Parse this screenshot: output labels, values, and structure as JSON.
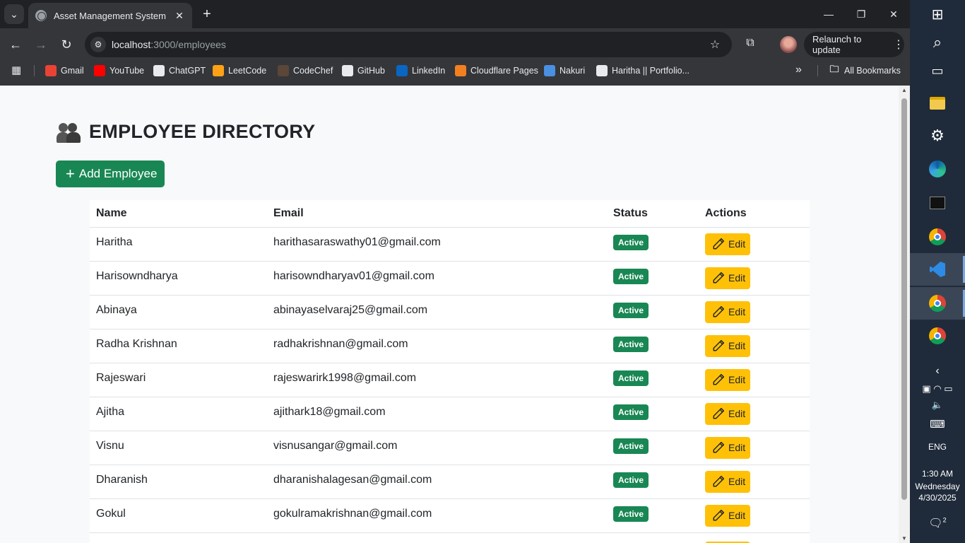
{
  "browser": {
    "tab_title": "Asset Management System",
    "url_host": "localhost",
    "url_path": ":3000/employees",
    "relaunch_label": "Relaunch to update",
    "bookmarks": [
      {
        "label": "Gmail",
        "icon": "gmail-icon",
        "color": "#ea4335"
      },
      {
        "label": "YouTube",
        "icon": "youtube-icon",
        "color": "#ff0000"
      },
      {
        "label": "ChatGPT",
        "icon": "chatgpt-icon",
        "color": "#e8eaed"
      },
      {
        "label": "LeetCode",
        "icon": "leetcode-icon",
        "color": "#ffa116"
      },
      {
        "label": "CodeChef",
        "icon": "codechef-icon",
        "color": "#5b4638"
      },
      {
        "label": "GitHub",
        "icon": "github-icon",
        "color": "#e8eaed"
      },
      {
        "label": "LinkedIn",
        "icon": "linkedin-icon",
        "color": "#0a66c2"
      },
      {
        "label": "Cloudflare Pages",
        "icon": "cloudflare-icon",
        "color": "#f38020"
      },
      {
        "label": "Nakuri",
        "icon": "naukri-icon",
        "color": "#4a90e2"
      },
      {
        "label": "Haritha || Portfolio...",
        "icon": "globe-icon",
        "color": "#e8eaed"
      }
    ],
    "all_bookmarks_label": "All Bookmarks"
  },
  "page": {
    "title": "EMPLOYEE DIRECTORY",
    "add_button_label": "Add Employee",
    "table": {
      "headers": [
        "Name",
        "Email",
        "Status",
        "Actions"
      ],
      "edit_label": "Edit",
      "rows": [
        {
          "name": "Haritha",
          "email": "harithasaraswathy01@gmail.com",
          "status": "Active"
        },
        {
          "name": "Harisowndharya",
          "email": "harisowndharyav01@gmail.com",
          "status": "Active"
        },
        {
          "name": "Abinaya",
          "email": "abinayaselvaraj25@gmail.com",
          "status": "Active"
        },
        {
          "name": "Radha Krishnan",
          "email": "radhakrishnan@gmail.com",
          "status": "Active"
        },
        {
          "name": "Rajeswari",
          "email": "rajeswarirk1998@gmail.com",
          "status": "Active"
        },
        {
          "name": "Ajitha",
          "email": "ajithark18@gmail.com",
          "status": "Active"
        },
        {
          "name": "Visnu",
          "email": "visnusangar@gmail.com",
          "status": "Active"
        },
        {
          "name": "Dharanish",
          "email": "dharanishalagesan@gmail.com",
          "status": "Active"
        },
        {
          "name": "Gokul",
          "email": "gokulramakrishnan@gmail.com",
          "status": "Active"
        }
      ]
    },
    "colors": {
      "success": "#198754",
      "warning": "#ffc107"
    }
  },
  "taskbar": {
    "language": "ENG",
    "time": "1:30 AM",
    "day": "Wednesday",
    "date": "4/30/2025",
    "notification_count": "2"
  }
}
